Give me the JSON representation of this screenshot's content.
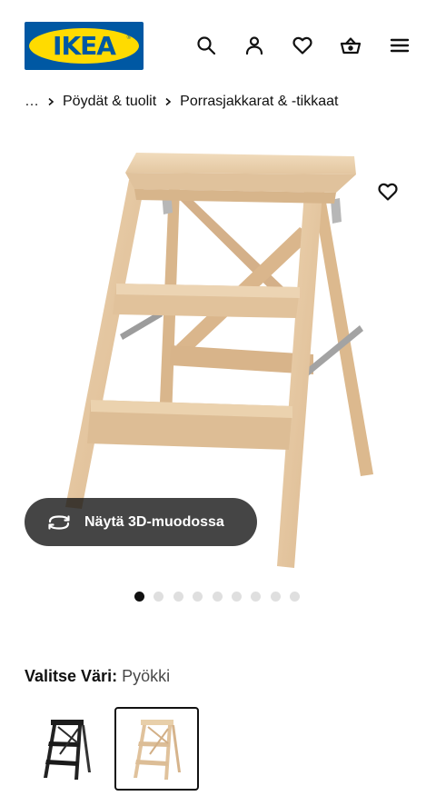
{
  "header": {
    "logo_text": "IKEA",
    "logo_colors": {
      "blue": "#0058a3",
      "yellow": "#ffdb00"
    },
    "icons": [
      "search-icon",
      "user-icon",
      "heart-icon",
      "basket-icon",
      "menu-icon"
    ]
  },
  "breadcrumb": {
    "ellipsis": "…",
    "items": [
      "Pöydät & tuolit",
      "Porrasjakkarat & -tikkaat"
    ]
  },
  "product": {
    "favorite_icon": "heart-icon",
    "view_3d_label": "Näytä 3D-muodossa",
    "view_3d_icon": "rotate-icon",
    "image_count": 9,
    "active_image_index": 0
  },
  "color_selector": {
    "label": "Valitse Väri:",
    "selected_value": "Pyökki",
    "options": [
      {
        "name": "black",
        "color": "#1c1c1c",
        "selected": false
      },
      {
        "name": "beech",
        "color": "#e4c9a4",
        "selected": true
      }
    ]
  }
}
